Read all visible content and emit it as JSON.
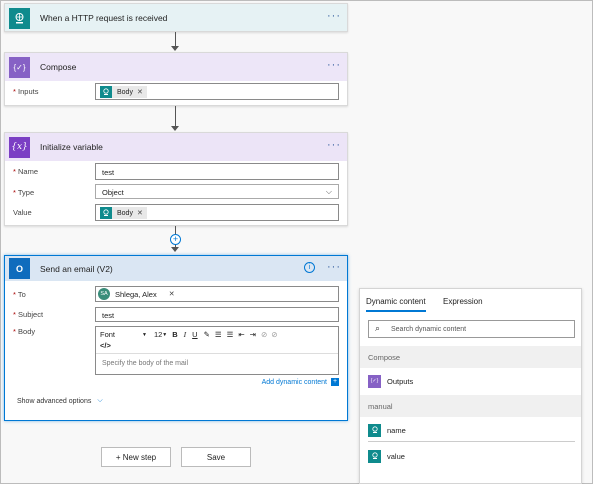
{
  "trigger": {
    "title": "When a HTTP request is received"
  },
  "compose": {
    "title": "Compose",
    "inputs_label": "Inputs",
    "inputs_token": "Body"
  },
  "init_var": {
    "title": "Initialize variable",
    "name_label": "Name",
    "name_value": "test",
    "type_label": "Type",
    "type_value": "Object",
    "value_label": "Value",
    "value_token": "Body"
  },
  "email": {
    "title": "Send an email (V2)",
    "to_label": "To",
    "to_initials": "SA",
    "to_value": "Shlega, Alex",
    "subject_label": "Subject",
    "subject_value": "test",
    "body_label": "Body",
    "font_value": "Font",
    "font_size": "12",
    "code_glyph": "</>",
    "body_placeholder": "Specify the body of the mail",
    "add_dynamic": "Add dynamic content",
    "show_advanced": "Show advanced options"
  },
  "buttons": {
    "new_step": "+ New step",
    "save": "Save"
  },
  "dynamic_panel": {
    "tab_dynamic": "Dynamic content",
    "tab_expression": "Expression",
    "search_placeholder": "Search dynamic content",
    "section_compose": "Compose",
    "item_outputs": "Outputs",
    "section_manual": "manual",
    "item_name": "name",
    "item_value": "value"
  },
  "colors": {
    "trigger_bg": "#e6f2f4",
    "trigger_icon": "#0f8b8d",
    "compose_bg": "#ede6f8",
    "compose_icon": "#8661c5",
    "var_bg": "#ece4f7",
    "var_icon": "#7b3fc4",
    "email_bg": "#dae6f3",
    "email_icon": "#0f6cbd",
    "accent": "#0078d4"
  }
}
